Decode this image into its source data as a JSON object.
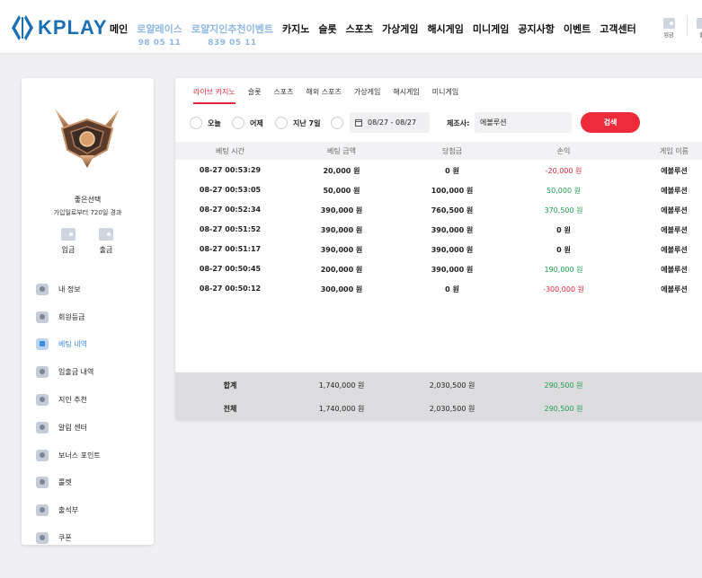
{
  "logo": {
    "text": "KPLAY",
    "brand_color": "#1a6fb5"
  },
  "nav": {
    "items": [
      {
        "label": "메인"
      },
      {
        "label": "로얄레이스",
        "sub": "98 05 11"
      },
      {
        "label": "로얄지인추천이벤트",
        "sub": "839 05 11"
      },
      {
        "label": "카지노"
      },
      {
        "label": "슬롯"
      },
      {
        "label": "스포츠"
      },
      {
        "label": "가상게임"
      },
      {
        "label": "해시게임"
      },
      {
        "label": "미니게임"
      },
      {
        "label": "공지사항"
      },
      {
        "label": "이벤트"
      },
      {
        "label": "고객센터"
      }
    ],
    "deposit_label": "입금",
    "withdraw_label": "출"
  },
  "profile": {
    "username": "좋은선택",
    "subtitle": "가입일로부터 720일 경과",
    "deposit_label": "입금",
    "withdraw_label": "출금"
  },
  "sidebar": {
    "items": [
      {
        "label": "내 정보",
        "icon": "user-icon"
      },
      {
        "label": "회원등급",
        "icon": "shield-icon"
      },
      {
        "label": "베팅 내역",
        "icon": "history-icon",
        "active": true
      },
      {
        "label": "입출금 내역",
        "icon": "wallet-icon"
      },
      {
        "label": "지인 추천",
        "icon": "heart-icon"
      },
      {
        "label": "알림 센터",
        "icon": "bell-icon"
      },
      {
        "label": "보너스 포인트",
        "icon": "gift-icon"
      },
      {
        "label": "룰렛",
        "icon": "roulette-icon"
      },
      {
        "label": "출석부",
        "icon": "calendar-icon"
      },
      {
        "label": "쿠폰",
        "icon": "coupon-icon"
      }
    ]
  },
  "tabs": [
    "라이브 카지노",
    "슬롯",
    "스포츠",
    "해외 스포츠",
    "가상게임",
    "해시게임",
    "미니게임"
  ],
  "filter": {
    "radios": [
      "오늘",
      "어제",
      "지난 7일",
      ""
    ],
    "date_range": "08/27 - 08/27",
    "maker_label": "제조사:",
    "maker_value": "에볼루션",
    "search_label": "검색"
  },
  "table": {
    "headers": [
      "베팅 시간",
      "베팅 금액",
      "당첨금",
      "손익",
      "게임 이름"
    ],
    "rows": [
      {
        "time": "08-27 00:53:29",
        "bet": "20,000 원",
        "win": "0 원",
        "pl": "-20,000 원",
        "pl_sign": "neg",
        "game": "에볼루션"
      },
      {
        "time": "08-27 00:53:05",
        "bet": "50,000 원",
        "win": "100,000 원",
        "pl": "50,000 원",
        "pl_sign": "pos",
        "game": "에볼루션"
      },
      {
        "time": "08-27 00:52:34",
        "bet": "390,000 원",
        "win": "760,500 원",
        "pl": "370,500 원",
        "pl_sign": "pos",
        "game": "에볼루션"
      },
      {
        "time": "08-27 00:51:52",
        "bet": "390,000 원",
        "win": "390,000 원",
        "pl": "0 원",
        "pl_sign": "zero",
        "game": "에볼루션"
      },
      {
        "time": "08-27 00:51:17",
        "bet": "390,000 원",
        "win": "390,000 원",
        "pl": "0 원",
        "pl_sign": "zero",
        "game": "에볼루션"
      },
      {
        "time": "08-27 00:50:45",
        "bet": "200,000 원",
        "win": "390,000 원",
        "pl": "190,000 원",
        "pl_sign": "pos",
        "game": "에볼루션"
      },
      {
        "time": "08-27 00:50:12",
        "bet": "300,000 원",
        "win": "0 원",
        "pl": "-300,000 원",
        "pl_sign": "neg",
        "game": "에볼루션"
      }
    ],
    "summary": [
      {
        "label": "합계",
        "bet": "1,740,000 원",
        "win": "2,030,500 원",
        "pl": "290,500 원"
      },
      {
        "label": "전체",
        "bet": "1,740,000 원",
        "win": "2,030,500 원",
        "pl": "290,500 원"
      }
    ]
  },
  "colors": {
    "accent_red": "#e0263a",
    "profit_green": "#1c9d4c",
    "active_blue": "#3a8ee6"
  }
}
